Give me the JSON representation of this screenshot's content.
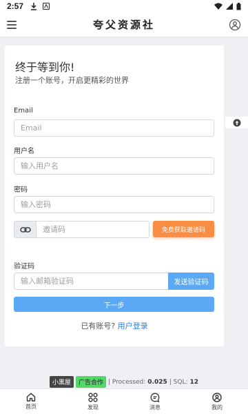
{
  "statusbar": {
    "time": "2:57"
  },
  "header": {
    "title": "夸父资源社"
  },
  "card": {
    "welcome": "终于等到你!",
    "subtitle": "注册一个账号，开启更精彩的世界"
  },
  "form": {
    "email_label": "Email",
    "email_placeholder": "Email",
    "username_label": "用户名",
    "username_placeholder": "输入用户名",
    "password_label": "密码",
    "password_placeholder": "输入密码",
    "invite_placeholder": "邀请码",
    "invite_button": "免费获取邀请码",
    "code_label": "验证码",
    "code_placeholder": "输入邮箱验证码",
    "send_code_button": "发送验证码",
    "next_button": "下一步",
    "have_account": "已有账号?",
    "login_link": "用户登录"
  },
  "footer": {
    "badge_dark": "小黑屋",
    "badge_green": "广告合作",
    "processed_label": "| Processed:",
    "processed_value": "0.025",
    "sql_label": "| SQL:",
    "sql_value": "12"
  },
  "tabs": [
    {
      "label": "首页",
      "icon": "home-icon"
    },
    {
      "label": "发现",
      "icon": "grid-icon"
    },
    {
      "label": "消息",
      "icon": "message-icon"
    },
    {
      "label": "我的",
      "icon": "user-icon"
    }
  ]
}
